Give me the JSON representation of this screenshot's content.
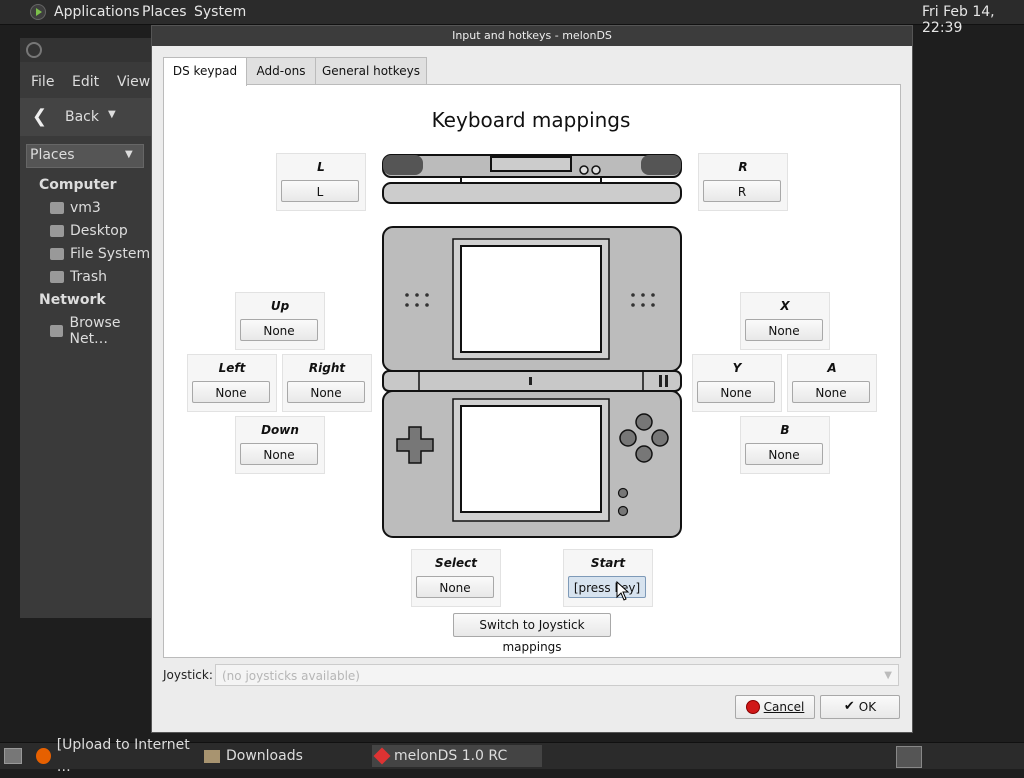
{
  "top_panel": {
    "menus": [
      "Applications",
      "Places",
      "System"
    ],
    "clock": "Fri Feb 14, 22:39"
  },
  "file_manager": {
    "menus": [
      "File",
      "Edit",
      "View"
    ],
    "back_label": "Back",
    "places_label": "Places",
    "sidebar": {
      "computer_header": "Computer",
      "computer_items": [
        "vm3",
        "Desktop",
        "File System",
        "Trash"
      ],
      "network_header": "Network",
      "network_items": [
        "Browse Net…"
      ]
    }
  },
  "dialog": {
    "title": "Input and hotkeys - melonDS",
    "tabs": [
      "DS keypad",
      "Add-ons",
      "General hotkeys"
    ],
    "heading": "Keyboard mappings",
    "mappings": {
      "L": {
        "label": "L",
        "value": "L"
      },
      "R": {
        "label": "R",
        "value": "R"
      },
      "Up": {
        "label": "Up",
        "value": "None"
      },
      "Left": {
        "label": "Left",
        "value": "None"
      },
      "Right": {
        "label": "Right",
        "value": "None"
      },
      "Down": {
        "label": "Down",
        "value": "None"
      },
      "X": {
        "label": "X",
        "value": "None"
      },
      "Y": {
        "label": "Y",
        "value": "None"
      },
      "A": {
        "label": "A",
        "value": "None"
      },
      "B": {
        "label": "B",
        "value": "None"
      },
      "Select": {
        "label": "Select",
        "value": "None"
      },
      "Start": {
        "label": "Start",
        "value": "[press key]"
      }
    },
    "switch_button": "Switch to Joystick mappings",
    "joystick_label": "Joystick:",
    "joystick_placeholder": "(no joysticks available)",
    "cancel_label": "Cancel",
    "ok_label": "OK"
  },
  "taskbar": {
    "items": [
      "[Upload to Internet …",
      "Downloads",
      "melonDS 1.0 RC"
    ]
  }
}
